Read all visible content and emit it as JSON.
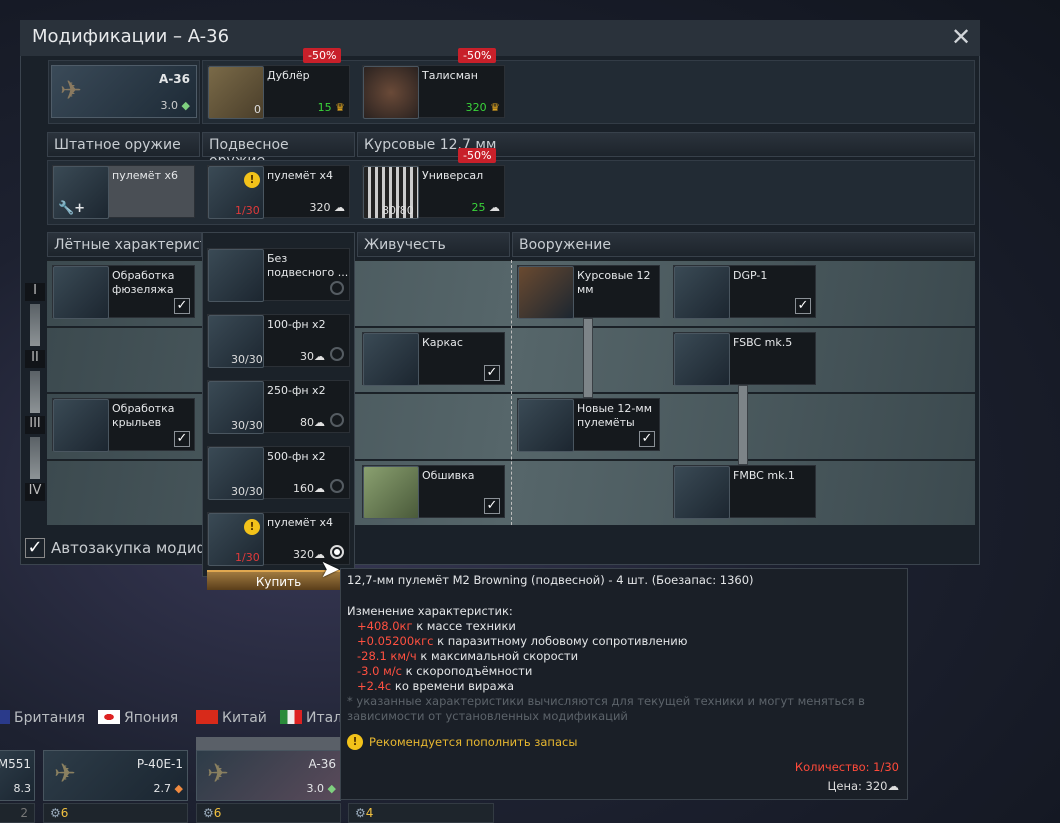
{
  "window": {
    "title": "Модификации – A-36",
    "close_icon": "close-icon"
  },
  "vehicle": {
    "name": "A-36",
    "br": "3.0"
  },
  "crew_items": [
    {
      "name": "Дублёр",
      "count": "0",
      "price": "15",
      "discount": "-50%"
    },
    {
      "name": "Талисман",
      "price": "320",
      "discount": "-50%"
    }
  ],
  "weapon_headers": [
    "Штатное оружие",
    "Подвесное оружие",
    "Курсовые 12.7 мм"
  ],
  "weapons": [
    {
      "name": "пулемёт x6"
    },
    {
      "name": "пулемёт x4",
      "count": "1/30",
      "price": "320"
    },
    {
      "name": "Универсал",
      "count": "80/80",
      "price": "25",
      "discount": "-50%"
    }
  ],
  "sections": [
    "Лётные характеристи",
    "Живучесть",
    "Вооружение"
  ],
  "tiers": [
    "I",
    "II",
    "III",
    "IV"
  ],
  "mods": {
    "flight": [
      {
        "name": "Обработка фюзеляжа"
      },
      {
        "name": "Обработка крыльев"
      }
    ],
    "survival": [
      {
        "name": "Каркас"
      },
      {
        "name": "Обшивка"
      }
    ],
    "weapons": [
      {
        "name": "Курсовые 12 мм"
      },
      {
        "name": "DGP-1"
      },
      {
        "name": "FSBC mk.5"
      },
      {
        "name": "Новые 12-мм пулемёты"
      },
      {
        "name": "FMBC mk.1"
      }
    ]
  },
  "autobuy": {
    "label": "Автозакупка модифи",
    "checked": true
  },
  "popup": {
    "items": [
      {
        "name": "Без подвесного ...",
        "selected": false
      },
      {
        "name": "100-фн x2",
        "count": "30/30",
        "price": "30",
        "selected": false
      },
      {
        "name": "250-фн x2",
        "count": "30/30",
        "price": "80",
        "selected": false
      },
      {
        "name": "500-фн x2",
        "count": "30/30",
        "price": "160",
        "selected": false
      },
      {
        "name": "пулемёт x4",
        "count": "1/30",
        "price": "320",
        "selected": true
      }
    ],
    "buy_label": "Купить"
  },
  "tooltip": {
    "title": "12,7-мм пулемёт M2 Browning (подвесной) - 4 шт. (Боезапас: 1360)",
    "changes_heading": "Изменение характеристик:",
    "changes": [
      {
        "value": "+408.0кг",
        "text": " к массе техники"
      },
      {
        "value": "+0.05200кгс",
        "text": " к паразитному лобовому сопротивлению"
      },
      {
        "value": "-28.1 км/ч",
        "text": " к максимальной скорости"
      },
      {
        "value": "-3.0 м/с",
        "text": " к скороподъёмности"
      },
      {
        "value": "+2.4с",
        "text": " ко времени виража"
      }
    ],
    "note": "* указанные характеристики вычисляются для текущей техники и могут меняться в зависимости от установленных модификаций",
    "warning": "Рекомендуется пополнить запасы",
    "quantity": "Количество: 1/30",
    "price": "Цена: 320"
  },
  "nations": [
    "Британия",
    "Япония",
    "Китай",
    "Итал"
  ],
  "hangar": [
    {
      "name": "M551",
      "br": "8.3",
      "crew": "2"
    },
    {
      "name": "P-40E-1",
      "br": "2.7",
      "crew": "6"
    },
    {
      "name": "A-36",
      "br": "3.0",
      "crew": "6"
    },
    {
      "crew": "4"
    }
  ],
  "colors": {
    "discount": "#c8202a",
    "positive": "#3ad43a",
    "negative": "#ff5040",
    "warning": "#f2c21a"
  }
}
